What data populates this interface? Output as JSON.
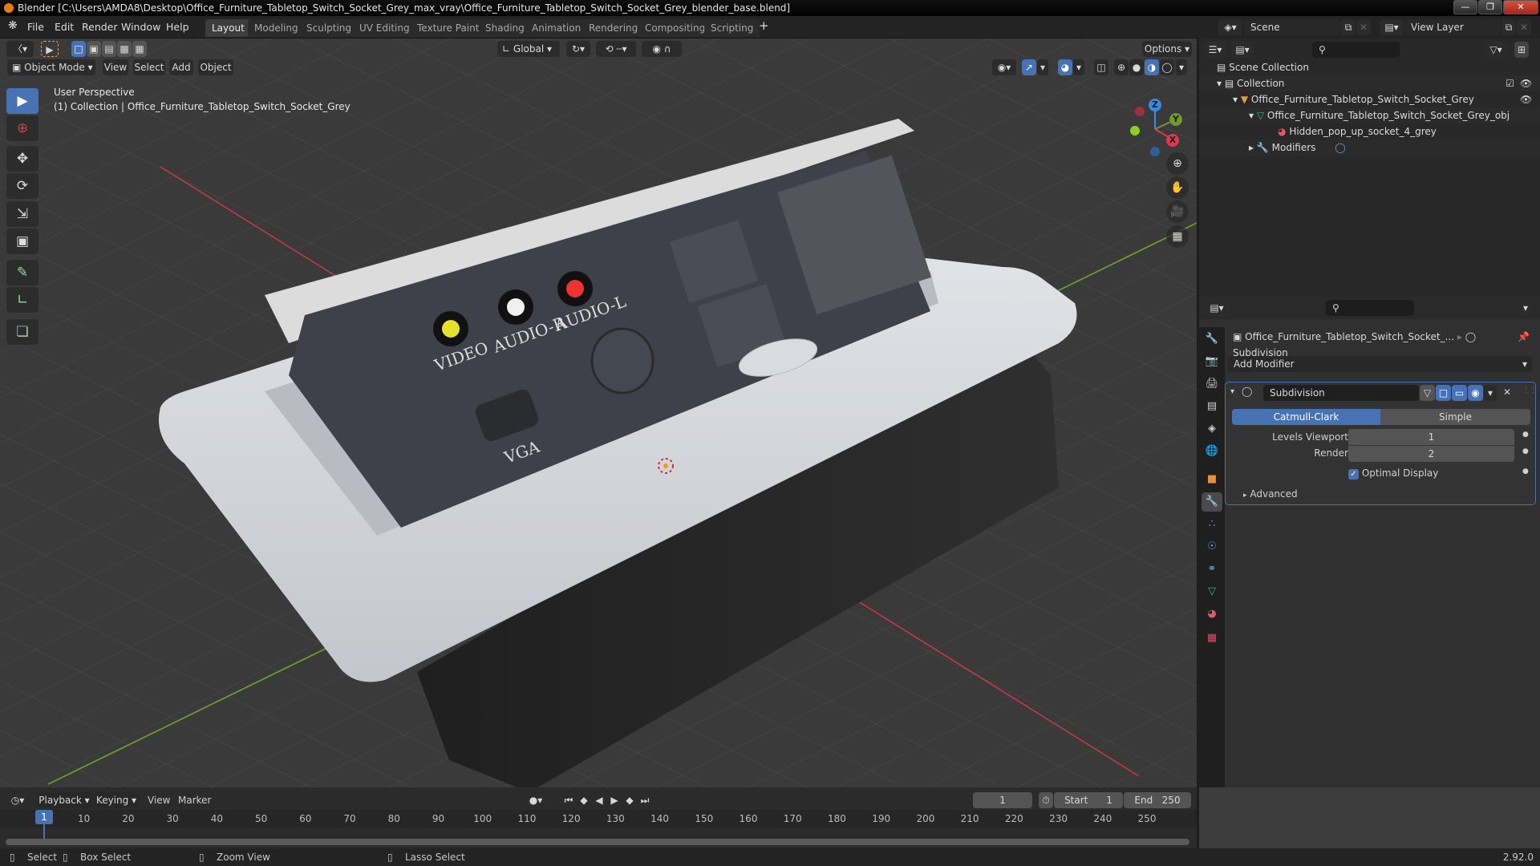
{
  "window": {
    "title": "Blender [C:\\Users\\AMDA8\\Desktop\\Office_Furniture_Tabletop_Switch_Socket_Grey_max_vray\\Office_Furniture_Tabletop_Switch_Socket_Grey_blender_base.blend]",
    "controls": [
      "minimize",
      "maximize",
      "close"
    ]
  },
  "menubar": {
    "menus": [
      "File",
      "Edit",
      "Render",
      "Window",
      "Help"
    ],
    "workspaces": [
      "Layout",
      "Modeling",
      "Sculpting",
      "UV Editing",
      "Texture Paint",
      "Shading",
      "Animation",
      "Rendering",
      "Compositing",
      "Scripting"
    ],
    "active_workspace": "Layout",
    "add_workspace": "+"
  },
  "viewport": {
    "mode": "Object Mode",
    "menus": [
      "View",
      "Select",
      "Add",
      "Object"
    ],
    "transform_orientation": "Global",
    "options_label": "Options",
    "overlay_text": {
      "perspective": "User Perspective",
      "collection_info": "(1) Collection | Office_Furniture_Tabletop_Switch_Socket_Grey"
    },
    "gizmo_axes": [
      "Z",
      "Y",
      "X"
    ],
    "object_labels": [
      "VIDEO",
      "AUDIO-R",
      "AUDIO-L",
      "VGA"
    ]
  },
  "toolbar": {
    "tools": [
      "select-box",
      "cursor",
      "move",
      "rotate",
      "scale",
      "transform",
      "annotate",
      "measure",
      "add-cube"
    ],
    "active_tool": "select-box"
  },
  "outliner": {
    "scene_label": "Scene",
    "view_layer_label": "View Layer",
    "items": [
      {
        "label": "Scene Collection",
        "icon": "scene-collection-icon",
        "depth": 0
      },
      {
        "label": "Collection",
        "icon": "collection-icon",
        "depth": 1
      },
      {
        "label": "Office_Furniture_Tabletop_Switch_Socket_Grey",
        "icon": "object-icon",
        "depth": 2
      },
      {
        "label": "Office_Furniture_Tabletop_Switch_Socket_Grey_obj",
        "icon": "mesh-data-icon",
        "depth": 3
      },
      {
        "label": "Hidden_pop_up_socket_4_grey",
        "icon": "material-icon",
        "depth": 4
      },
      {
        "label": "Modifiers",
        "icon": "wrench-icon",
        "depth": 3
      }
    ]
  },
  "properties": {
    "breadcrumb_object": "Office_Furniture_Tabletop_Switch_Socket_...",
    "breadcrumb_modifier": "Subdivision",
    "add_modifier_label": "Add Modifier",
    "modifier": {
      "name": "Subdivision",
      "types": [
        "Catmull-Clark",
        "Simple"
      ],
      "active_type": "Catmull-Clark",
      "levels_viewport_label": "Levels Viewport",
      "levels_viewport": "1",
      "render_label": "Render",
      "render": "2",
      "optimal_display_label": "Optimal Display",
      "optimal_display": true,
      "advanced_label": "Advanced"
    },
    "tabs": [
      "tool",
      "render",
      "output",
      "view-layer",
      "scene",
      "world",
      "object",
      "modifiers",
      "particles",
      "physics",
      "constraints",
      "data",
      "material",
      "texture"
    ],
    "active_tab": "modifiers"
  },
  "timeline": {
    "menus": [
      "Playback",
      "Keying",
      "View",
      "Marker"
    ],
    "current_frame": "1",
    "start_label": "Start",
    "start": "1",
    "end_label": "End",
    "end": "250",
    "ticks": [
      "1",
      "10",
      "20",
      "30",
      "40",
      "50",
      "60",
      "70",
      "80",
      "90",
      "100",
      "110",
      "120",
      "130",
      "140",
      "150",
      "160",
      "170",
      "180",
      "190",
      "200",
      "210",
      "220",
      "230",
      "240",
      "250"
    ]
  },
  "statusbar": {
    "items": [
      "Select",
      "Box Select",
      "Zoom View",
      "Lasso Select"
    ],
    "version": "2.92.0"
  },
  "colors": {
    "accent": "#4772b3",
    "x_axis": "#e0384e",
    "y_axis": "#6f9a2c",
    "z_axis": "#3a8ae8"
  }
}
